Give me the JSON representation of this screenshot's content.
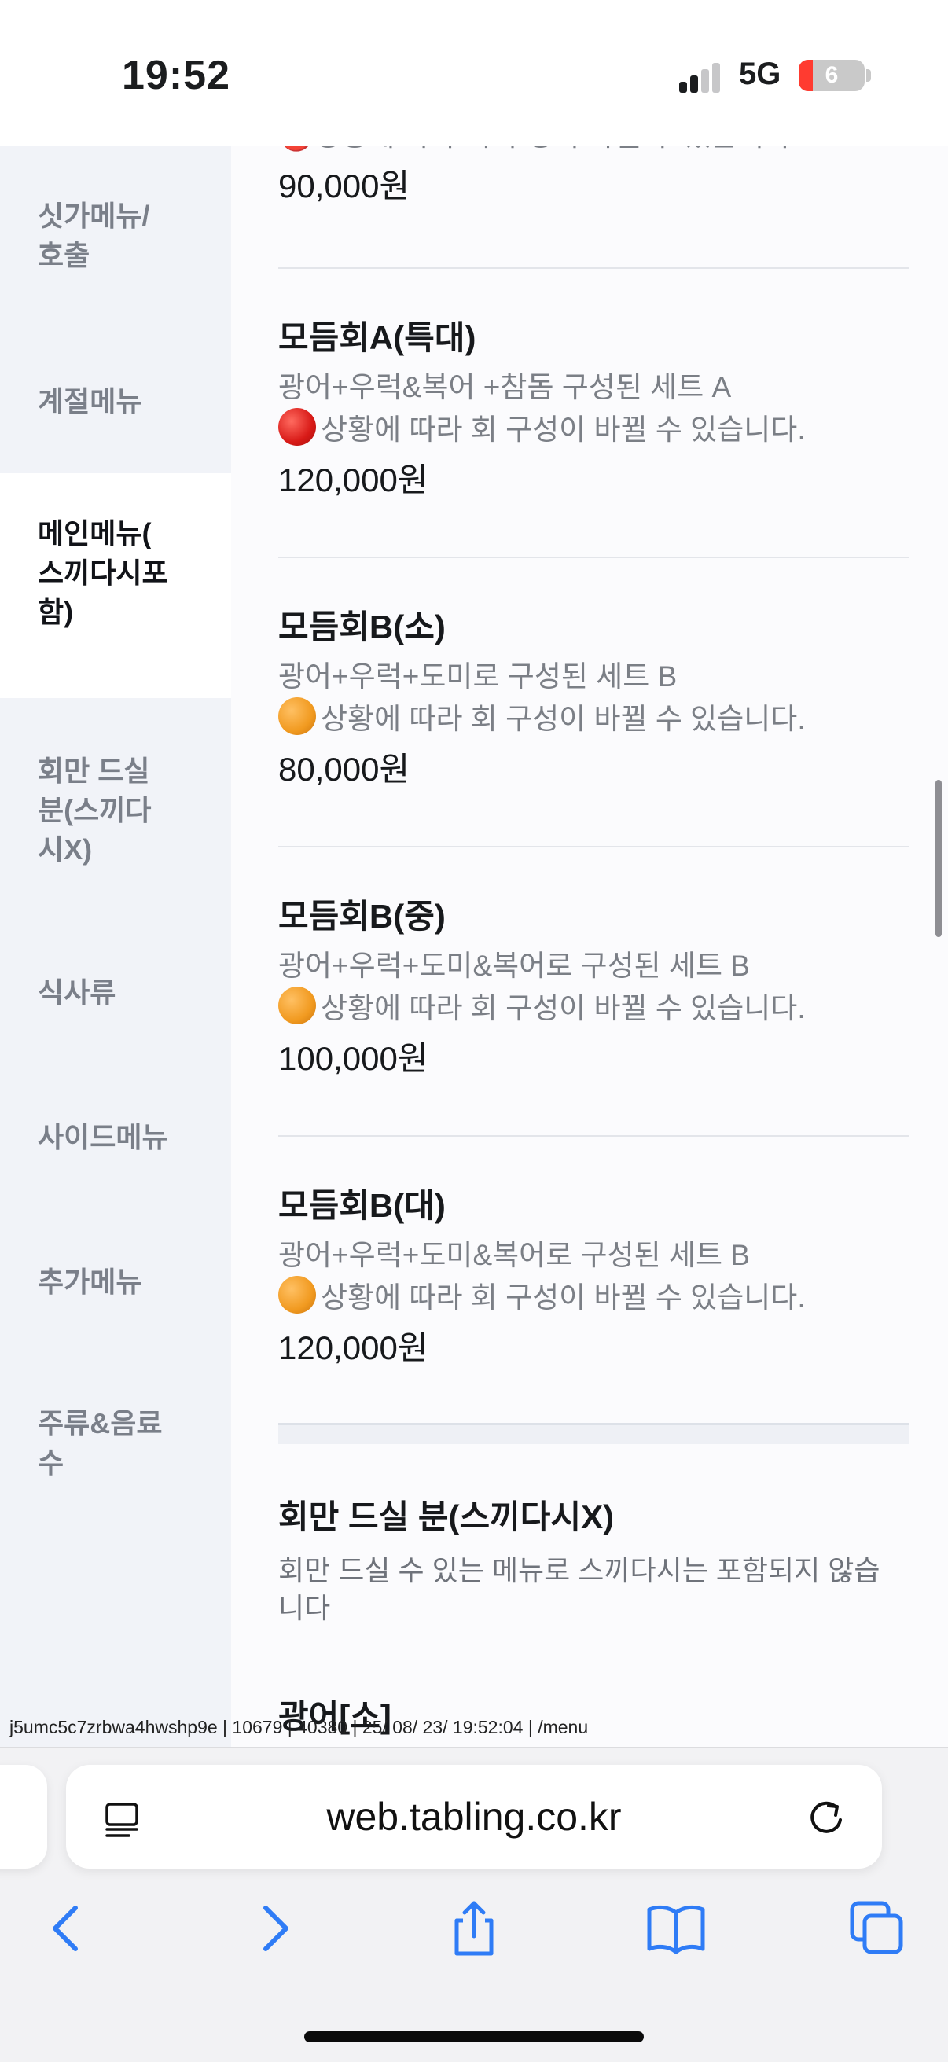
{
  "status_bar": {
    "time": "19:52",
    "network": "5G",
    "battery": "6"
  },
  "sidebar": {
    "items": [
      {
        "label": "싯가메뉴/\n호출",
        "active": false
      },
      {
        "label": "계절메뉴",
        "active": false
      },
      {
        "label": "메인메뉴(\n스끼다시포\n함)",
        "active": true
      },
      {
        "label": "회만 드실\n분(스끼다\n시X)",
        "active": false
      },
      {
        "label": "식사류",
        "active": false
      },
      {
        "label": "사이드메뉴",
        "active": false
      },
      {
        "label": "추가메뉴",
        "active": false
      },
      {
        "label": "주류&음료\n수",
        "active": false
      }
    ]
  },
  "menu": {
    "partial_top": {
      "desc_cut": "🔴상황에 따라 회 구성이 바뀔 수 있습니다.",
      "price": "90,000원"
    },
    "items": [
      {
        "name": "모듬회A(특대)",
        "desc1": "광어+우럭&복어 +참돔 구성된 세트 A",
        "note": "상황에 따라 회 구성이 바뀔 수 있습니다.",
        "dot": "red",
        "price": "120,000원"
      },
      {
        "name": "모듬회B(소)",
        "desc1": "광어+우럭+도미로 구성된 세트 B",
        "note": "상황에 따라 회 구성이 바뀔 수 있습니다.",
        "dot": "orange",
        "price": "80,000원"
      },
      {
        "name": "모듬회B(중)",
        "desc1": "광어+우럭+도미&복어로 구성된 세트 B",
        "note": "상황에 따라 회 구성이 바뀔 수 있습니다.",
        "dot": "orange",
        "price": "100,000원"
      },
      {
        "name": "모듬회B(대)",
        "desc1": "광어+우럭+도미&복어로 구성된 세트 B",
        "note": "상황에 따라 회 구성이 바뀔 수 있습니다.",
        "dot": "orange",
        "price": "120,000원"
      }
    ],
    "next_section": {
      "title": "회만 드실 분(스끼다시X)",
      "desc": "회만 드실 수 있는 메뉴로 스끼다시는 포함되지 않습\n니다",
      "first_item_cut": "광어[소]"
    }
  },
  "debug_line": "j5umc5c7zrbwa4hwshp9e | 10679 | 40380 | 25/ 08/ 23/ 19:52:04 | /menu",
  "browser": {
    "url": "web.tabling.co.kr"
  },
  "icons": {
    "reader": "reader-icon",
    "reload": "reload-icon",
    "back": "back-icon",
    "forward": "forward-icon",
    "share": "share-icon",
    "bookmarks": "book-icon",
    "tabs": "tabs-icon"
  },
  "colors": {
    "accent_blue": "#2f7cf6",
    "sidebar_bg": "#f1f3f8",
    "note_red": "#d81a17",
    "note_orange": "#f19a20"
  }
}
